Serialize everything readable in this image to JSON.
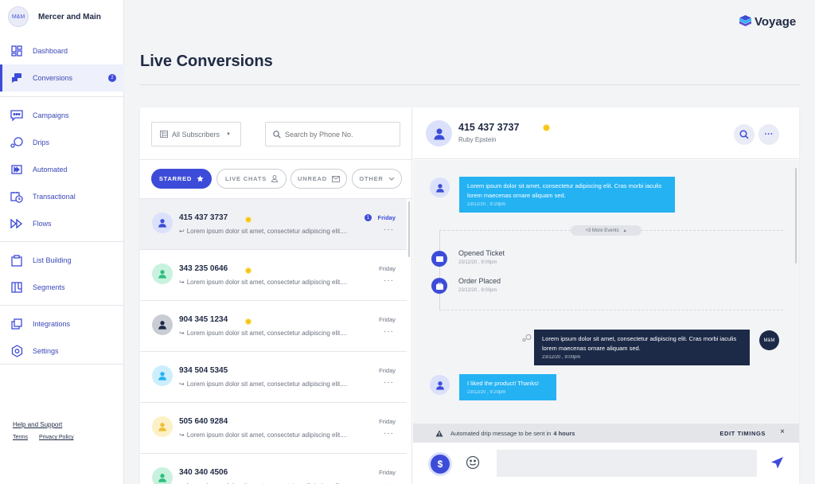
{
  "brand": {
    "avatar": "M&M",
    "name": "Mercer and Main"
  },
  "sidebar": {
    "items": [
      {
        "label": "Dashboard",
        "icon": "dashboard-icon"
      },
      {
        "label": "Conversions",
        "icon": "chat-icon",
        "badge": "2",
        "active": true
      },
      {
        "label": "Campaigns",
        "icon": "message-dots-icon"
      },
      {
        "label": "Drips",
        "icon": "drips-icon"
      },
      {
        "label": "Automated",
        "icon": "fast-forward-icon"
      },
      {
        "label": "Transactional",
        "icon": "calendar-clock-icon"
      },
      {
        "label": "Flows",
        "icon": "flows-icon"
      },
      {
        "label": "List Building",
        "icon": "clipboard-icon"
      },
      {
        "label": "Segments",
        "icon": "segments-icon"
      },
      {
        "label": "Integrations",
        "icon": "integrations-icon"
      },
      {
        "label": "Settings",
        "icon": "settings-icon"
      }
    ],
    "help": "Help and Support",
    "terms": "Terms",
    "privacy": "Privacy Policy"
  },
  "logo": "Voyage",
  "page_title": "Live Conversions",
  "filters": {
    "subscribers": "All Subscribers",
    "search_placeholder": "Search by Phone No.",
    "chips": [
      "STARRED",
      "LIVE CHATS",
      "UNREAD",
      "OTHER"
    ]
  },
  "conversations": [
    {
      "phone": "415 437 3737",
      "preview": "Lorem ipsum dolor sit amet, consectetur adipiscing elit....",
      "day": "Friday",
      "unread": "1",
      "starred": true,
      "reply": true,
      "avatar_color": "#dbe0fb",
      "icon_color": "#3d4cd8"
    },
    {
      "phone": "343 235 0646",
      "preview": "Lorem ipsum dolor sit amet, consectetur adipiscing elit....",
      "day": "Friday",
      "starred": true,
      "avatar_color": "#c8f2df",
      "icon_color": "#2fbf7e"
    },
    {
      "phone": "904 345 1234",
      "preview": "Lorem ipsum dolor sit amet, consectetur adipiscing elit....",
      "day": "Friday",
      "starred": true,
      "avatar_color": "#c9ccd3",
      "icon_color": "#1c2a48"
    },
    {
      "phone": "934 504 5345",
      "preview": "Lorem ipsum dolor sit amet, consectetur adipiscing elit....",
      "day": "Friday",
      "avatar_color": "#cdeefc",
      "icon_color": "#24b2f3"
    },
    {
      "phone": "505 640 9284",
      "preview": "Lorem ipsum dolor sit amet, consectetur adipiscing elit....",
      "day": "Friday",
      "avatar_color": "#fdf0c6",
      "icon_color": "#e8c03a"
    },
    {
      "phone": "340 340 4506",
      "preview": "Lorem ipsum dolor sit amet, consectetur adipiscing elit....",
      "day": "Friday",
      "avatar_color": "#c8f2df",
      "icon_color": "#2fbf7e"
    }
  ],
  "contact": {
    "phone": "415 437 3737",
    "name": "Ruby Epstein"
  },
  "messages": {
    "m1": {
      "text": "Lorem ipsum dolor sit amet, consectetur adipiscing elit. Cras morbi iaculis lorem maecenas ornare aliquam sed.",
      "time": "23/12/20 , 9:20pm"
    },
    "more_events": "+3 More Events",
    "events": [
      {
        "title": "Opened Ticket",
        "time": "23/12/20 , 9:00pm"
      },
      {
        "title": "Order Placed",
        "time": "23/12/20 , 9:00pm"
      }
    ],
    "m2": {
      "text": "Lorem ipsum dolor sit amet, consectetur adipiscing elit. Cras morbi iaculis lorem maecenas ornare aliquam sed.",
      "time": "23/12/20 , 9:00pm",
      "avatar": "M&M"
    },
    "m3": {
      "text": "I liked the product! Thanks!",
      "time": "23/12/20 , 9:20pm"
    }
  },
  "banner": {
    "text": "Automated drip message to be sent in",
    "bold": "4 hours",
    "action": "EDIT TIMINGS",
    "close": "×"
  },
  "composer": {
    "currency": "$"
  },
  "colors": {
    "accent": "#3d4cd8",
    "bubble_blue": "#24b2f3",
    "bubble_dark": "#1c2a48",
    "star": "#f5c518"
  }
}
